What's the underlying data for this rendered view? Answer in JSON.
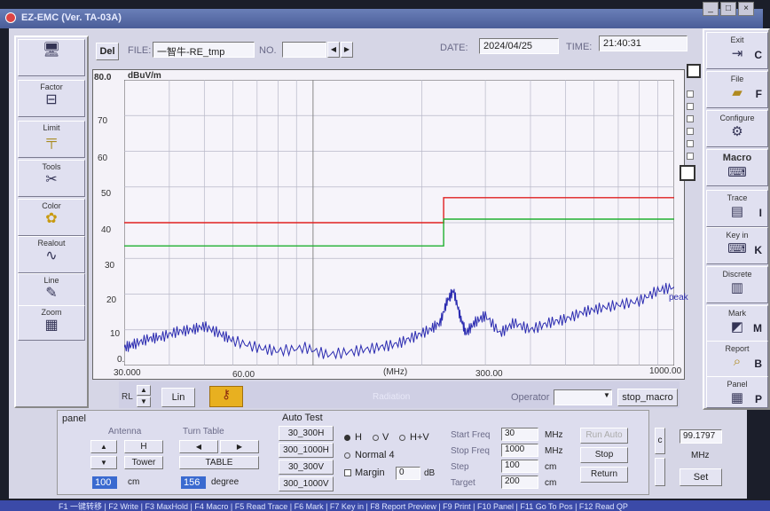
{
  "window": {
    "title": "EZ-EMC (Ver. TA-03A)",
    "minimize": "_",
    "maximize": "□",
    "close": "×"
  },
  "left_toolbar": [
    {
      "label": "",
      "icon": "computer-icon"
    },
    {
      "label": "Factor",
      "icon": "factor-icon"
    },
    {
      "label": "Limit",
      "icon": "limit-icon"
    },
    {
      "label": "Tools",
      "icon": "tools-icon"
    },
    {
      "label": "Color",
      "icon": "color-icon"
    },
    {
      "label": "Realout",
      "icon": "realout-icon"
    },
    {
      "label": "Line",
      "icon": "line-icon"
    },
    {
      "label": "Zoom",
      "icon": "zoom-icon"
    }
  ],
  "right_toolbar": [
    {
      "label": "Exit",
      "key": "C"
    },
    {
      "label": "File",
      "key": "F"
    },
    {
      "label": "Configure",
      "key": ""
    },
    {
      "label": "Macro",
      "key": ""
    },
    {
      "label": "Trace",
      "key": "I"
    },
    {
      "label": "Key in",
      "key": "K"
    },
    {
      "label": "Discrete",
      "key": ""
    },
    {
      "label": "Mark",
      "key": "M"
    },
    {
      "label": "Report",
      "key": "B"
    },
    {
      "label": "Panel",
      "key": "P"
    }
  ],
  "header": {
    "del_label": "Del",
    "file_label": "FILE:",
    "file_value": "一智牛-RE_tmp",
    "no_label": "NO.",
    "no_value": "",
    "date_label": "DATE:",
    "date_value": "2024/04/25",
    "time_label": "TIME:",
    "time_value": "21:40:31"
  },
  "graph": {
    "y_unit": "dBuV/m",
    "y_top_label": "80.0",
    "y_ticks": [
      "70",
      "60",
      "50",
      "40",
      "30",
      "20",
      "10",
      "0.0"
    ],
    "x_ticks": [
      "30.000",
      "60.00",
      "(MHz)",
      "300.00",
      "1000.00"
    ],
    "trace_label": "peak"
  },
  "chart_data": {
    "type": "line",
    "xlabel": "(MHz)",
    "ylabel": "dBuV/m",
    "ylim": [
      0,
      80
    ],
    "xlim": [
      30,
      1000
    ],
    "x_scale": "log",
    "series": [
      {
        "name": "",
        "color": "#e02020",
        "x": [
          30,
          230,
          230,
          1000
        ],
        "y": [
          40,
          40,
          47,
          47
        ]
      },
      {
        "name": "",
        "color": "#20b030",
        "x": [
          30,
          230,
          230,
          1000
        ],
        "y": [
          33.5,
          33.5,
          41,
          41
        ]
      },
      {
        "name": "peak",
        "color": "#2b2bb0",
        "x": [
          30,
          32,
          35,
          38,
          42,
          46,
          50,
          55,
          60,
          70,
          80,
          95,
          110,
          130,
          150,
          170,
          190,
          210,
          225,
          235,
          245,
          255,
          265,
          280,
          300,
          330,
          360,
          400,
          450,
          500,
          560,
          620,
          700,
          800,
          900,
          1000
        ],
        "y": [
          5,
          6,
          7.5,
          8,
          9.5,
          10,
          11,
          9,
          7,
          5,
          4,
          5,
          3,
          4,
          5,
          6,
          8,
          10,
          12,
          18,
          21,
          14,
          9,
          12,
          14,
          9,
          12,
          10,
          12,
          13,
          15,
          16,
          17,
          18,
          21,
          22
        ]
      }
    ]
  },
  "graph_controls": {
    "rl_label": "RL",
    "lin_label": "Lin",
    "center_title": "Radiation",
    "operator_label": "Operator",
    "operator_value": "",
    "stop_macro_label": "stop_macro"
  },
  "panel": {
    "title": "panel",
    "antenna_label": "Antenna",
    "antenna_h": "H",
    "antenna_tower": "Tower",
    "antenna_value": "100",
    "antenna_unit": "cm",
    "turntable_label": "Turn Table",
    "turntable_table": "TABLE",
    "turntable_value": "156",
    "turntable_unit": "degree"
  },
  "auto_test": {
    "title": "Auto Test",
    "buttons": [
      "30_300H",
      "300_1000H",
      "30_300V",
      "300_1000V"
    ],
    "radio_h": "H",
    "radio_v": "V",
    "radio_hv": "H+V",
    "normal_label": "Normal 4",
    "margin_label": "Margin",
    "margin_value": "0",
    "margin_unit": "dB"
  },
  "scan": {
    "start_label": "Start Freq",
    "start_value": "30",
    "start_unit": "MHz",
    "stop_label": "Stop Freq",
    "stop_value": "1000",
    "stop_unit": "MHz",
    "step_label": "Step",
    "step_value": "100",
    "step_unit": "cm",
    "target_label": "Target",
    "target_value": "200",
    "target_unit": "cm",
    "run_auto": "Run Auto",
    "stop": "Stop",
    "return": "Return"
  },
  "freq_box": {
    "c_label": "c",
    "value": "99.1797",
    "unit": "MHz",
    "set_label": "Set"
  },
  "statusbar": {
    "text": "F1 一键转移 | F2 Write | F3 MaxHold | F4 Macro | F5 Read Trace | F6 Mark | F7 Key in | F8 Report Preview | F9 Print | F10 Panel | F11 Go To Pos | F12 Read QP"
  }
}
